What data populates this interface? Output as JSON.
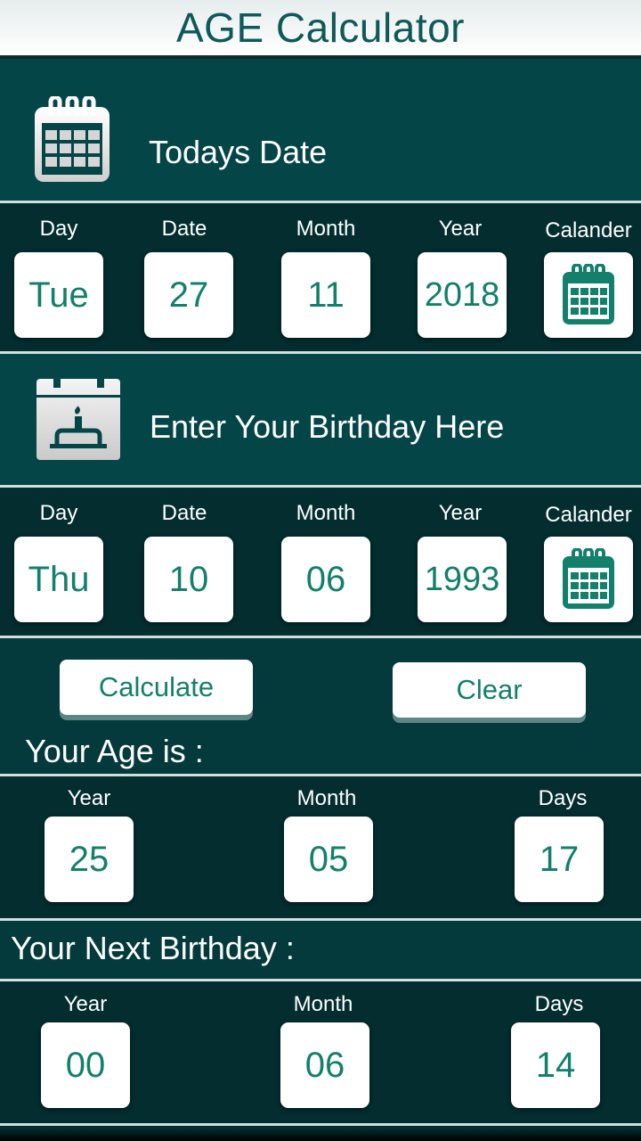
{
  "app": {
    "title": "AGE Calculator"
  },
  "colors": {
    "accent": "#12806a",
    "header_band": "#044548",
    "dark_band": "#032d2f"
  },
  "today": {
    "heading": "Todays Date",
    "heading_icon": "calendar-icon",
    "labels": {
      "day": "Day",
      "date": "Date",
      "month": "Month",
      "year": "Year",
      "calendar": "Calander"
    },
    "values": {
      "day": "Tue",
      "date": "27",
      "month": "11",
      "year": "2018"
    },
    "calendar_icon": "calendar-icon"
  },
  "birthday": {
    "heading": "Enter Your Birthday Here",
    "heading_icon": "birthday-cake-calendar-icon",
    "labels": {
      "day": "Day",
      "date": "Date",
      "month": "Month",
      "year": "Year",
      "calendar": "Calander"
    },
    "values": {
      "day": "Thu",
      "date": "10",
      "month": "06",
      "year": "1993"
    },
    "calendar_icon": "calendar-icon"
  },
  "actions": {
    "calculate_label": "Calculate",
    "clear_label": "Clear"
  },
  "age": {
    "title": "Your Age is :",
    "labels": {
      "year": "Year",
      "month": "Month",
      "days": "Days"
    },
    "values": {
      "year": "25",
      "month": "05",
      "days": "17"
    }
  },
  "next_birthday": {
    "title": "Your Next Birthday :",
    "labels": {
      "year": "Year",
      "month": "Month",
      "days": "Days"
    },
    "values": {
      "year": "00",
      "month": "06",
      "days": "14"
    }
  }
}
